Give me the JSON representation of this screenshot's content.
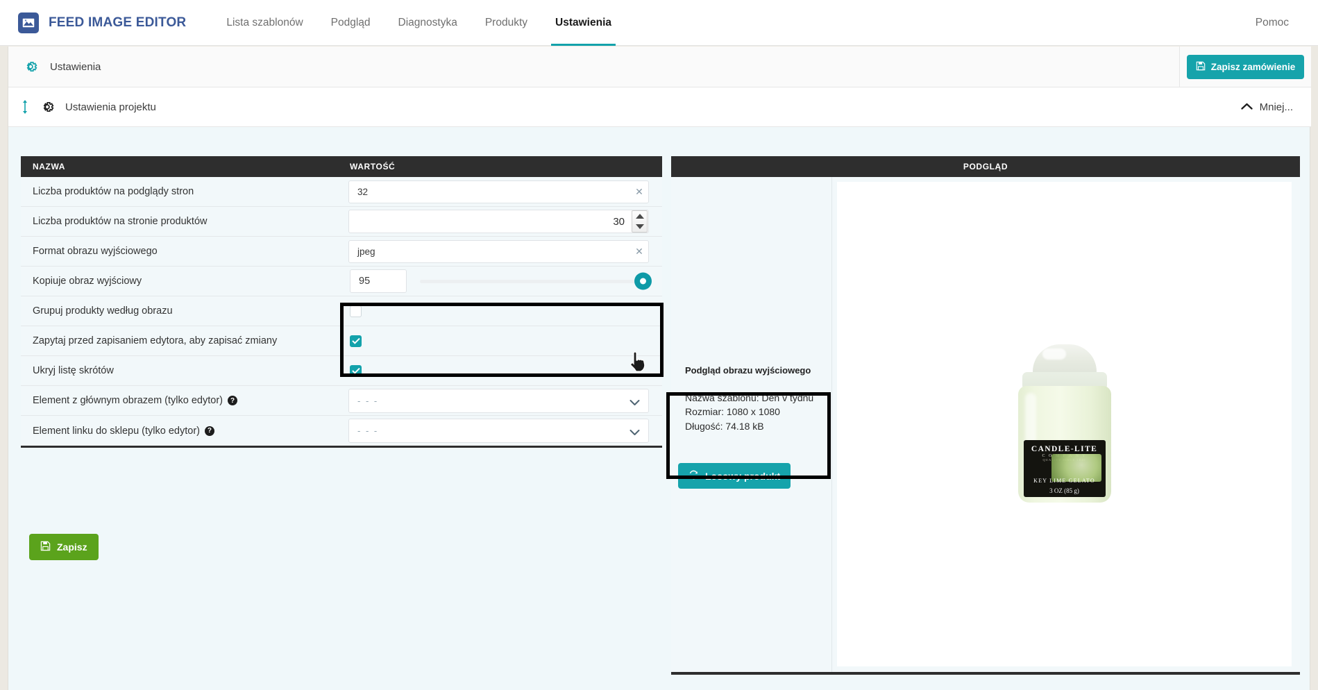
{
  "navbar": {
    "brand": "FEED IMAGE EDITOR",
    "logo_icon": "image-picture-icon",
    "links": [
      {
        "label": "Lista szablonów",
        "active": false
      },
      {
        "label": "Podgląd",
        "active": false
      },
      {
        "label": "Diagnostyka",
        "active": false
      },
      {
        "label": "Produkty",
        "active": false
      },
      {
        "label": "Ustawienia",
        "active": true
      }
    ],
    "help_label": "Pomoc"
  },
  "section": {
    "title": "Ustawienia",
    "gear_icon": "gear-icon",
    "save_order_label": "Zapisz zamówienie",
    "save_order_icon": "floppy-disk-icon"
  },
  "project_bar": {
    "title": "Ustawienia projektu",
    "gear_icon": "gear-icon",
    "drag_icon": "vertical-drag-icon",
    "collapse_label": "Mniej...",
    "collapse_icon": "chevron-up-icon"
  },
  "settings_table": {
    "headers": {
      "name": "NAZWA",
      "value": "WARTOŚĆ"
    },
    "rows": [
      {
        "name": "Liczba produktów na podglądy stron",
        "control": "text-clear",
        "value": "32",
        "clear_icon": "close-x-icon"
      },
      {
        "name": "Liczba produktów na stronie produktów",
        "control": "number-spinner",
        "value": "30",
        "spinner_icon": "up-down-arrows-icon"
      },
      {
        "name": "Format obrazu wyjściowego",
        "control": "text-clear",
        "value": "jpeg",
        "clear_icon": "close-x-icon",
        "highlighted": true
      },
      {
        "name": "Kopiuje obraz wyjściowy",
        "control": "slider",
        "value": "95",
        "slider_percent": 100,
        "highlighted": true
      },
      {
        "name": "Grupuj produkty według obrazu",
        "control": "checkbox",
        "checked": false
      },
      {
        "name": "Zapytaj przed zapisaniem edytora, aby zapisać zmiany",
        "control": "checkbox",
        "checked": true
      },
      {
        "name": "Ukryj listę skrótów",
        "control": "checkbox",
        "checked": true
      },
      {
        "name": "Element z głównym obrazem (tylko edytor)",
        "control": "select",
        "value": "- - -",
        "help_icon": "question-mark-icon",
        "help_glyph": "?",
        "caret_icon": "chevron-down-icon"
      },
      {
        "name": "Element linku do sklepu (tylko edytor)",
        "control": "select",
        "value": "- - -",
        "help_icon": "question-mark-icon",
        "help_glyph": "?",
        "caret_icon": "chevron-down-icon"
      }
    ],
    "save_label": "Zapisz",
    "save_icon": "floppy-disk-icon"
  },
  "preview": {
    "header": "PODGLĄD",
    "info_title": "Podgląd obrazu wyjściowego",
    "info_template": "Nazwa szablonu: Den v týdnu",
    "info_size": "Rozmiar: 1080 x 1080",
    "info_length": "Długość: 74.18 kB",
    "random_label": "Losowy produkt",
    "random_icon": "refresh-icon",
    "product_image": {
      "brand": "CANDLE-LITE",
      "company": "C O M P A N Y",
      "since": "QUALITY SINCE 1840",
      "scent": "KEY LIME GELATO",
      "size": "3 OZ (85 g)"
    }
  },
  "colors": {
    "accent_teal": "#13a2ab",
    "brand_blue": "#3b5998",
    "save_green": "#5ba31c",
    "header_dark": "#2e2e2e",
    "page_bg": "#f0f8fa"
  }
}
